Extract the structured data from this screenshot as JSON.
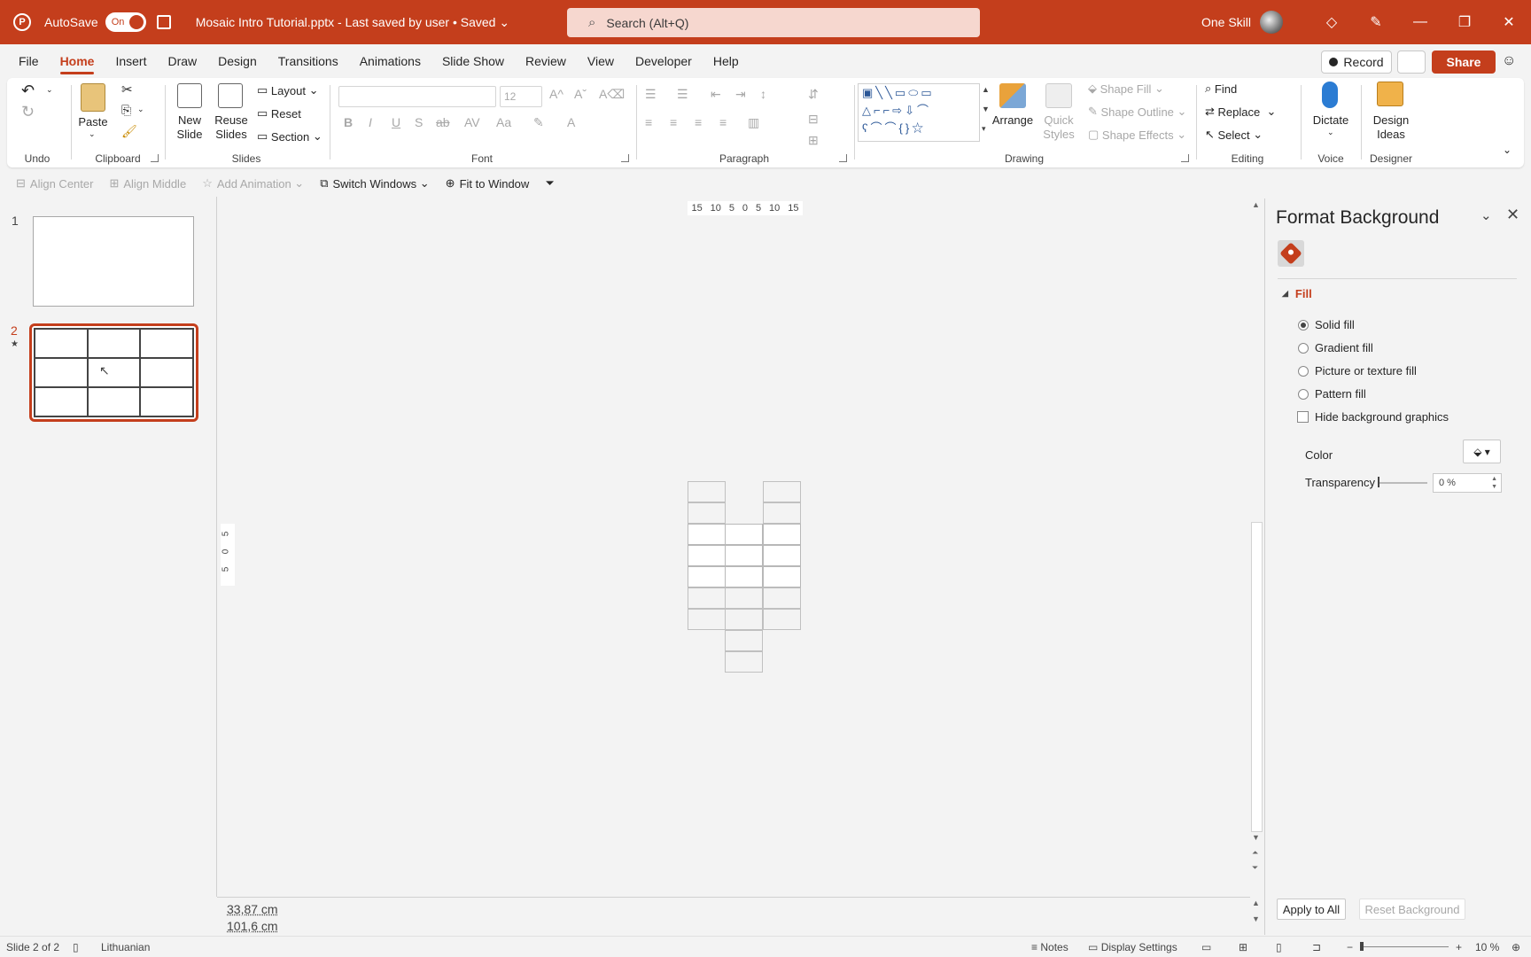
{
  "titlebar": {
    "autosave_label": "AutoSave",
    "toggle_state": "On",
    "document_title": "Mosaic Intro Tutorial.pptx  -  Last saved by user • Saved ⌄",
    "search_placeholder": "Search (Alt+Q)",
    "user_name": "One Skill"
  },
  "tabs": [
    {
      "label": "File"
    },
    {
      "label": "Home"
    },
    {
      "label": "Insert"
    },
    {
      "label": "Draw"
    },
    {
      "label": "Design"
    },
    {
      "label": "Transitions"
    },
    {
      "label": "Animations"
    },
    {
      "label": "Slide Show"
    },
    {
      "label": "Review"
    },
    {
      "label": "View"
    },
    {
      "label": "Developer"
    },
    {
      "label": "Help"
    }
  ],
  "active_tab": "Home",
  "right_buttons": {
    "record": "Record",
    "share": "Share"
  },
  "ribbon": {
    "undo_group": "Undo",
    "clipboard_group": "Clipboard",
    "paste": "Paste",
    "slides_group": "Slides",
    "new_slide": "New Slide",
    "reuse_slides": "Reuse Slides",
    "layout": "Layout",
    "reset": "Reset",
    "section": "Section",
    "font_group": "Font",
    "font_size": "12",
    "paragraph_group": "Paragraph",
    "drawing_group": "Drawing",
    "arrange": "Arrange",
    "quick_styles": "Quick Styles",
    "shape_fill": "Shape Fill",
    "shape_outline": "Shape Outline",
    "shape_effects": "Shape Effects",
    "editing_group": "Editing",
    "find": "Find",
    "replace": "Replace",
    "select": "Select",
    "voice_group": "Voice",
    "dictate": "Dictate",
    "designer_group": "Designer",
    "design_ideas": "Design Ideas"
  },
  "qat": {
    "align_center": "Align Center",
    "align_middle": "Align Middle",
    "add_animation": "Add Animation",
    "switch_windows": "Switch Windows",
    "fit_to_window": "Fit to Window"
  },
  "slides": [
    {
      "number": "1"
    },
    {
      "number": "2",
      "selected": true
    }
  ],
  "rulers": {
    "top": [
      "15",
      "10",
      "5",
      "0",
      "5",
      "10",
      "15"
    ],
    "left": [
      "5",
      "0",
      "5"
    ]
  },
  "dimensions": {
    "width": "33,87 cm",
    "height": "101,6 cm"
  },
  "format_pane": {
    "title": "Format Background",
    "section": "Fill",
    "options": [
      {
        "label": "Solid fill",
        "selected": true
      },
      {
        "label": "Gradient fill",
        "selected": false
      },
      {
        "label": "Picture or texture fill",
        "selected": false
      },
      {
        "label": "Pattern fill",
        "selected": false
      }
    ],
    "hide_bg_graphics": "Hide background graphics",
    "color_label": "Color",
    "transparency_label": "Transparency",
    "transparency_value": "0 %",
    "transparency_level": 0,
    "apply_all": "Apply to All",
    "reset_background": "Reset Background"
  },
  "status": {
    "slide_info": "Slide 2 of 2",
    "language": "Lithuanian",
    "notes": "Notes",
    "display_settings": "Display Settings",
    "zoom": "10 %"
  },
  "colors": {
    "accent": "#c43e1c",
    "background": "#f3f3f3"
  }
}
